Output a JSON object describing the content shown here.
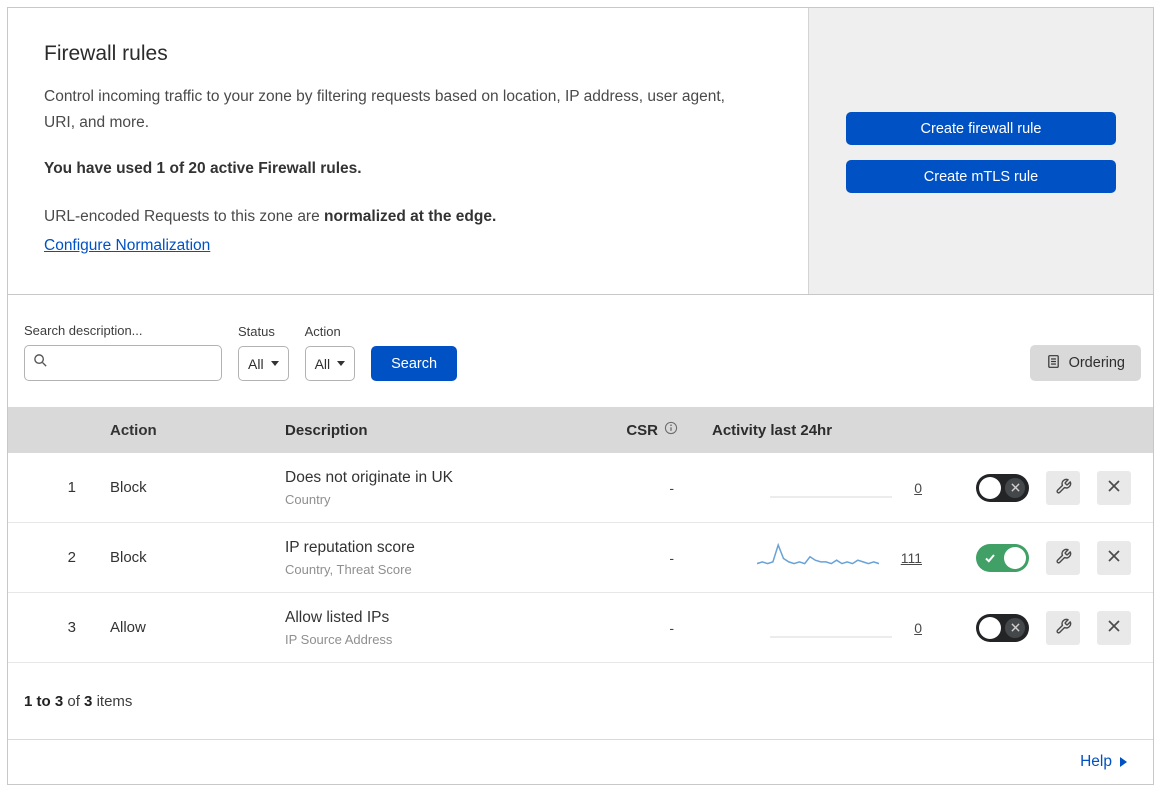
{
  "header": {
    "title": "Firewall rules",
    "description": "Control incoming traffic to your zone by filtering requests based on location, IP address, user agent, URI, and more.",
    "usage_note": "You have used 1 of 20 active Firewall rules.",
    "normalization_text": "URL-encoded Requests to this zone are ",
    "normalization_bold": "normalized at the edge.",
    "configure_link": "Configure Normalization",
    "create_firewall_button": "Create firewall rule",
    "create_mtls_button": "Create mTLS rule"
  },
  "filters": {
    "search_label": "Search description...",
    "search_value": "",
    "status_label": "Status",
    "status_value": "All",
    "action_label": "Action",
    "action_value": "All",
    "search_button": "Search",
    "ordering_button": "Ordering"
  },
  "table": {
    "headers": {
      "action": "Action",
      "description": "Description",
      "csr": "CSR",
      "activity": "Activity last 24hr"
    },
    "rows": [
      {
        "number": "1",
        "action": "Block",
        "description": "Does not originate in UK",
        "criteria": "Country",
        "csr": "-",
        "activity_count": "0",
        "enabled": false,
        "sparkline": []
      },
      {
        "number": "2",
        "action": "Block",
        "description": "IP reputation score",
        "criteria": "Country, Threat Score",
        "csr": "-",
        "activity_count": "111",
        "enabled": true,
        "sparkline": [
          2,
          3,
          2,
          3,
          13,
          5,
          3,
          2,
          3,
          2,
          6,
          4,
          3,
          3,
          2,
          4,
          2,
          3,
          2,
          4,
          3,
          2,
          3,
          2
        ]
      },
      {
        "number": "3",
        "action": "Allow",
        "description": "Allow listed IPs",
        "criteria": "IP Source Address",
        "csr": "-",
        "activity_count": "0",
        "enabled": false,
        "sparkline": []
      }
    ]
  },
  "footer": {
    "range": "1 to 3",
    "of_text": "of",
    "total": "3",
    "items_text": "items",
    "help_link": "Help"
  },
  "colors": {
    "accent_blue": "#0051c3",
    "toggle_on_green": "#40a065",
    "sparkline_blue": "#69a2d6",
    "flat_line_gray": "#d8d8d8"
  }
}
